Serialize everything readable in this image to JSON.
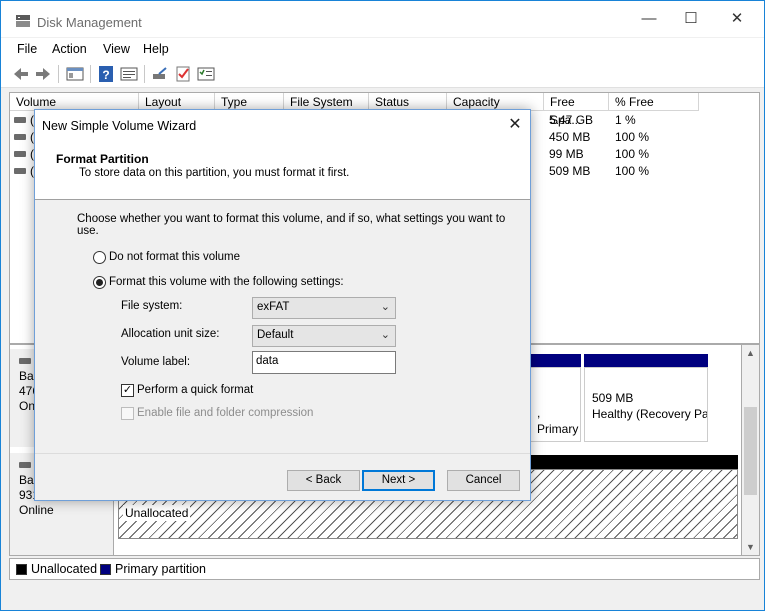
{
  "window": {
    "title": "Disk Management",
    "controls": {
      "minimize": "—",
      "maximize": "☐",
      "close": "✕"
    }
  },
  "menu": [
    "File",
    "Action",
    "View",
    "Help"
  ],
  "volume_list": {
    "columns": [
      "Volume",
      "Layout",
      "Type",
      "File System",
      "Status",
      "Capacity",
      "Free Spa...",
      "% Free"
    ],
    "rows": [
      {
        "volume": "(",
        "free": "5.47 GB",
        "pct": "1 %"
      },
      {
        "volume": "(",
        "free": "450 MB",
        "pct": "100 %"
      },
      {
        "volume": "(",
        "free": "99 MB",
        "pct": "100 %"
      },
      {
        "volume": "(",
        "free": "509 MB",
        "pct": "100 %"
      }
    ]
  },
  "disks": [
    {
      "line1": "Bas",
      "line2": "476",
      "line3": "On"
    },
    {
      "line1": "Bas",
      "line2": "931",
      "line3": "Online"
    }
  ],
  "partitions": {
    "primary_fragment": ", Primary",
    "recovery_size": "509 MB",
    "recovery_status": "Healthy (Recovery Pa",
    "unallocated_label": "Unallocated"
  },
  "legend": [
    {
      "label": "Unallocated",
      "color": "#000000"
    },
    {
      "label": "Primary partition",
      "color": "#00007f"
    }
  ],
  "wizard": {
    "title": "New Simple Volume Wizard",
    "close": "✕",
    "header_title": "Format Partition",
    "header_subtitle": "To store data on this partition, you must format it first.",
    "instruction": "Choose whether you want to format this volume, and if so, what settings you want to use.",
    "option_no_format": "Do not format this volume",
    "option_format": "Format this volume with the following settings:",
    "file_system_label": "File system:",
    "file_system_value": "exFAT",
    "alloc_label": "Allocation unit size:",
    "alloc_value": "Default",
    "volume_label_label": "Volume label:",
    "volume_label_value": "data",
    "quick_format_label": "Perform a quick format",
    "quick_format_checked": true,
    "compression_label": "Enable file and folder compression",
    "compression_enabled": false,
    "back_button": "< Back",
    "next_button": "Next >",
    "cancel_button": "Cancel"
  },
  "colors": {
    "accent": "#0078d7",
    "primary_partition": "#00007f",
    "unallocated": "#000000"
  }
}
